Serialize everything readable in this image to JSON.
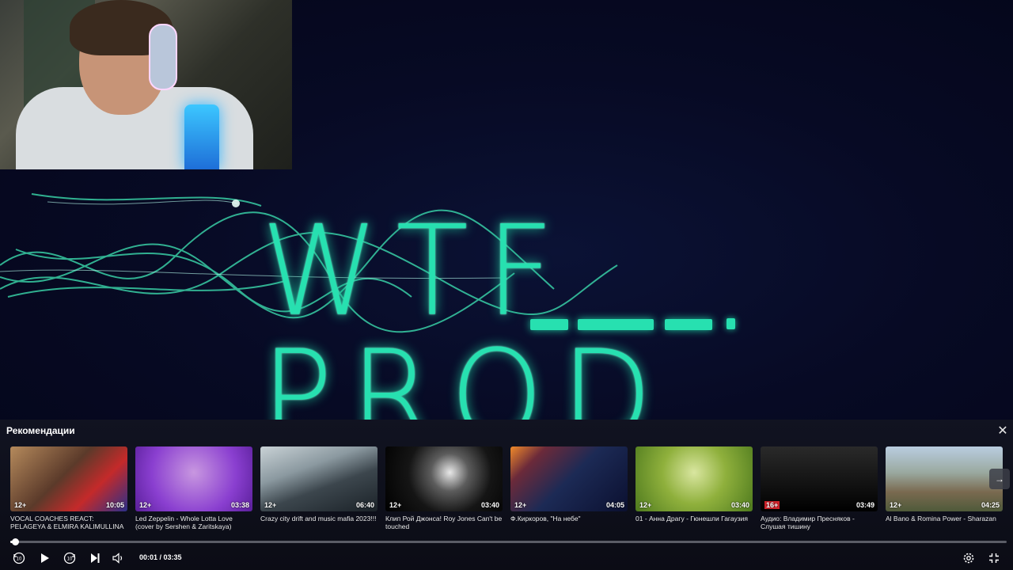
{
  "video": {
    "brand_text": "WTF PROD",
    "brand_color": "#27e0b0"
  },
  "recommendations": {
    "title": "Рекомендации",
    "close_icon": "close-icon",
    "next_icon": "arrow-right-icon",
    "items": [
      {
        "title": "VOCAL COACHES REACT: PELAGEYA & ELMIRA KALIMULLINA - CANÇÃO DO...",
        "age": "12+",
        "duration": "10:05",
        "thumb_color": "#8a6b4b"
      },
      {
        "title": "Led Zeppelin - Whole Lotta Love (cover by Sershen & Zaritskaya)",
        "age": "12+",
        "duration": "03:38",
        "thumb_color": "#8a3fd0"
      },
      {
        "title": "Crazy city drift and music mafia 2023!!!",
        "age": "12+",
        "duration": "06:40",
        "thumb_color": "#4a5660"
      },
      {
        "title": "Клип Рой Джонса! Roy Jones Can't be touched",
        "age": "12+",
        "duration": "03:40",
        "thumb_color": "#1a1a1a"
      },
      {
        "title": "Ф.Киркоров, \"На небе\"",
        "age": "12+",
        "duration": "04:05",
        "thumb_color": "#1c2a55"
      },
      {
        "title": "01 - Анна Драгу - Гюнешли Гагаузия",
        "age": "12+",
        "duration": "03:40",
        "thumb_color": "#7ea53a"
      },
      {
        "title": "Аудио: Владимир Пресняков - Слушая тишину",
        "age": "16+",
        "duration": "03:49",
        "thumb_color": "#111111"
      },
      {
        "title": "Al Bano & Romina Power - Sharazan",
        "age": "12+",
        "duration": "04:25",
        "thumb_color": "#7d9bb8"
      }
    ]
  },
  "player": {
    "current_time": "00:01",
    "total_time": "03:35",
    "time_display": "00:01 / 03:35",
    "progress_fraction": 0.005,
    "controls": {
      "rewind_icon": "rewind-10-icon",
      "play_icon": "play-icon",
      "forward_icon": "forward-10-icon",
      "next_icon": "skip-next-icon",
      "volume_icon": "volume-icon",
      "settings_icon": "gear-icon",
      "fullscreen_icon": "fullscreen-icon"
    }
  }
}
